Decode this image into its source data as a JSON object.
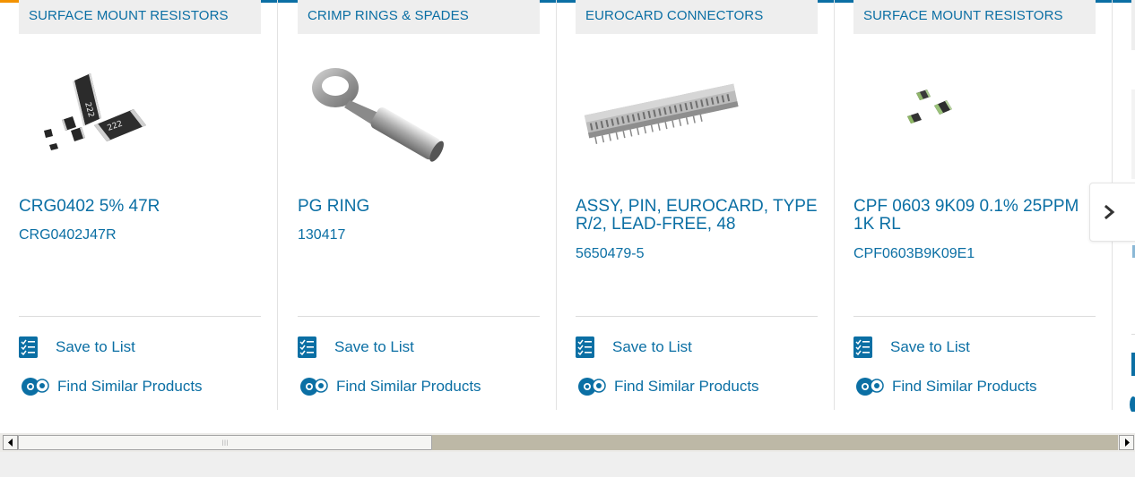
{
  "colors": {
    "brand_blue": "#0b6fa4",
    "accent_orange": "#f39200",
    "category_bg": "#eeeeee"
  },
  "cards": [
    {
      "category": "SURFACE MOUNT RESISTORS",
      "title": "CRG0402 5% 47R",
      "part_number": "CRG0402J47R",
      "image": "smd-resistor-chips",
      "save_label": "Save to List",
      "find_label": "Find Similar Products"
    },
    {
      "category": "CRIMP RINGS & SPADES",
      "title": "PG RING",
      "part_number": "130417",
      "image": "ring-terminal",
      "save_label": "Save to List",
      "find_label": "Find Similar Products"
    },
    {
      "category": "EUROCARD CONNECTORS",
      "title": "ASSY, PIN, EUROCARD, TYPE R/2, LEAD-FREE, 48",
      "part_number": "5650479-5",
      "image": "eurocard-connector",
      "save_label": "Save to List",
      "find_label": "Find Similar Products"
    },
    {
      "category": "SURFACE MOUNT RESISTORS",
      "title": "CPF 0603 9K09 0.1% 25PPM 1K RL",
      "part_number": "CPF0603B9K09E1",
      "image": "smd-resistor-chips-small",
      "save_label": "Save to List",
      "find_label": "Find Similar Products"
    }
  ],
  "carousel": {
    "next_icon": "chevron-right-icon"
  },
  "scrollbar": {
    "left_icon": "arrow-left-icon",
    "right_icon": "arrow-right-icon",
    "grip_text": "III"
  }
}
